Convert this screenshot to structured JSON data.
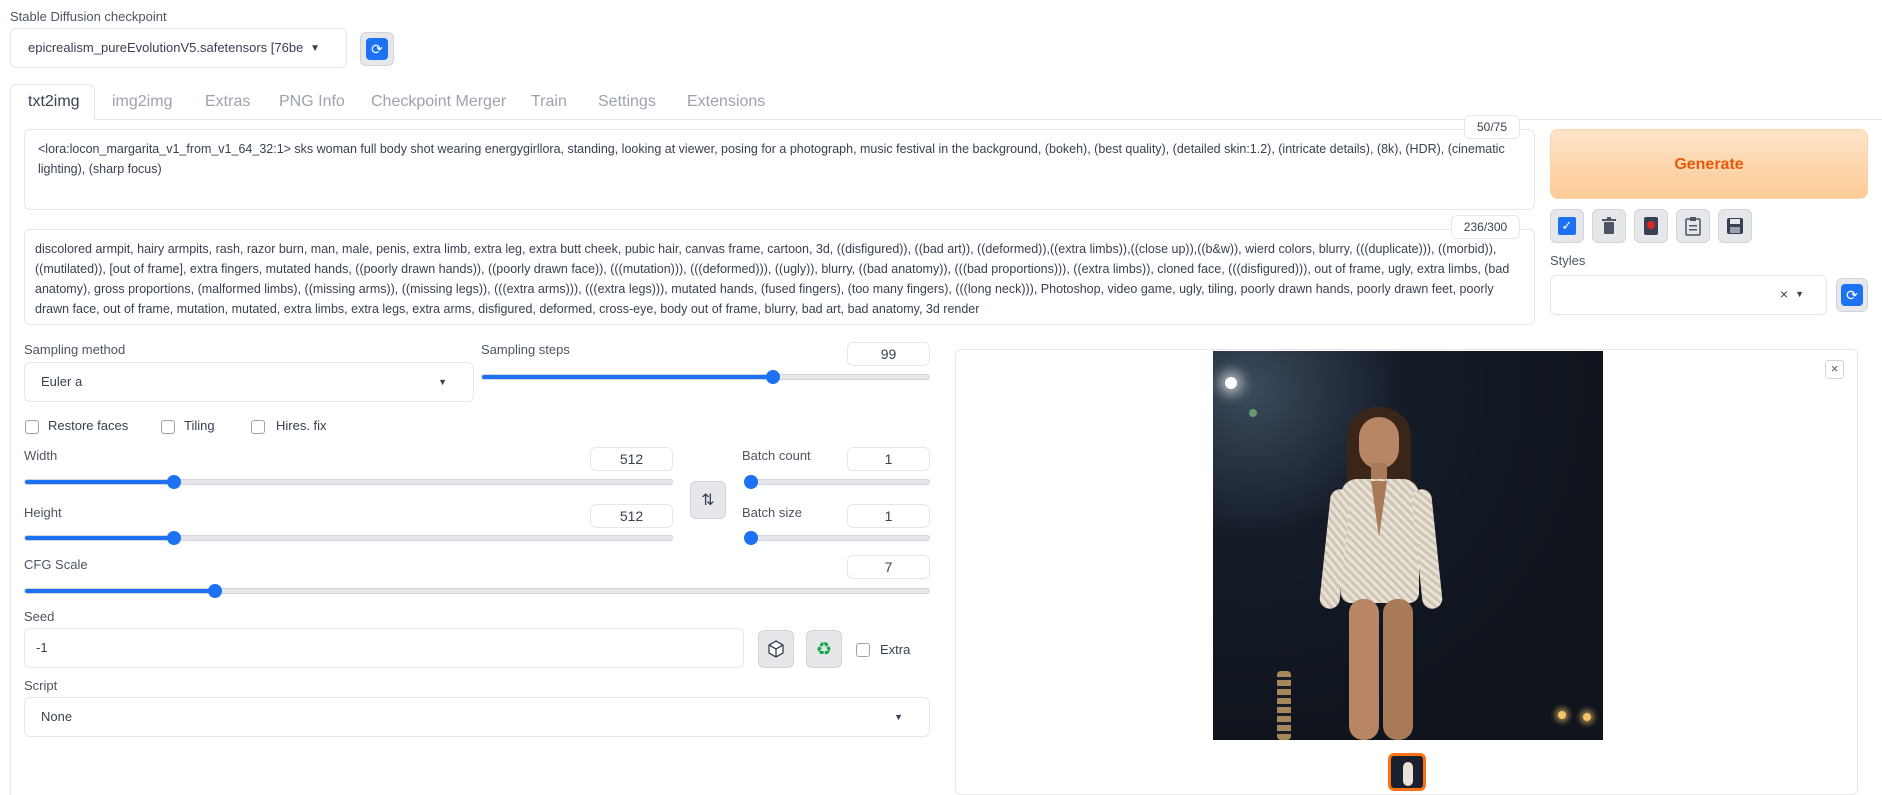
{
  "checkpoint": {
    "label": "Stable Diffusion checkpoint",
    "value": "epicrealism_pureEvolutionV5.safetensors [76be",
    "refresh_icon": "refresh-icon"
  },
  "tabs": [
    "txt2img",
    "img2img",
    "Extras",
    "PNG Info",
    "Checkpoint Merger",
    "Train",
    "Settings",
    "Extensions"
  ],
  "prompt": {
    "counter": "50/75",
    "text": "<lora:locon_margarita_v1_from_v1_64_32:1> sks woman full body shot  wearing energygirllora, standing, looking at viewer, posing for a photograph, music festival in the background, (bokeh), (best quality), (detailed skin:1.2), (intricate details), (8k), (HDR), (cinematic lighting), (sharp focus)"
  },
  "negative_prompt": {
    "counter": "236/300",
    "text": "discolored armpit, hairy armpits, rash, razor burn, man, male, penis, extra limb, extra leg, extra butt cheek, pubic hair, canvas frame, cartoon, 3d, ((disfigured)), ((bad art)), ((deformed)),((extra limbs)),((close up)),((b&w)), wierd colors, blurry, (((duplicate))), ((morbid)), ((mutilated)), [out of frame], extra fingers, mutated hands, ((poorly drawn hands)), ((poorly drawn face)), (((mutation))), (((deformed))), ((ugly)), blurry, ((bad anatomy)), (((bad proportions))), ((extra limbs)), cloned face, (((disfigured))), out of frame, ugly, extra limbs, (bad anatomy), gross proportions, (malformed limbs), ((missing arms)), ((missing legs)), (((extra arms))), (((extra legs))), mutated hands, (fused fingers), (too many fingers), (((long neck))), Photoshop, video game, ugly, tiling, poorly drawn hands, poorly drawn feet, poorly drawn face, out of frame, mutation, mutated, extra limbs, extra legs, extra arms, disfigured, deformed, cross-eye, body out of frame, blurry, bad art, bad anatomy, 3d render"
  },
  "generate": {
    "label": "Generate"
  },
  "tool_icons": [
    "checkbox-icon",
    "trash-icon",
    "card-icon",
    "clipboard-icon",
    "save-icon"
  ],
  "styles": {
    "label": "Styles",
    "value": ""
  },
  "sampling": {
    "method_label": "Sampling method",
    "method_value": "Euler a",
    "steps_label": "Sampling steps",
    "steps_value": "99",
    "steps_fraction": 0.65
  },
  "checkboxes": {
    "restore_faces": "Restore faces",
    "tiling": "Tiling",
    "hires_fix": "Hires. fix"
  },
  "width": {
    "label": "Width",
    "value": "512",
    "fraction": 0.23
  },
  "height": {
    "label": "Height",
    "value": "512",
    "fraction": 0.23
  },
  "batch_count": {
    "label": "Batch count",
    "value": "1",
    "fraction": 0.0
  },
  "batch_size": {
    "label": "Batch size",
    "value": "1",
    "fraction": 0.0
  },
  "cfg": {
    "label": "CFG Scale",
    "value": "7",
    "fraction": 0.21
  },
  "seed": {
    "label": "Seed",
    "value": "-1",
    "extra_label": "Extra"
  },
  "script": {
    "label": "Script",
    "value": "None"
  },
  "colors": {
    "accent": "#1d72f3",
    "generate_bg": "#fed7aa",
    "generate_text": "#ea580c"
  }
}
